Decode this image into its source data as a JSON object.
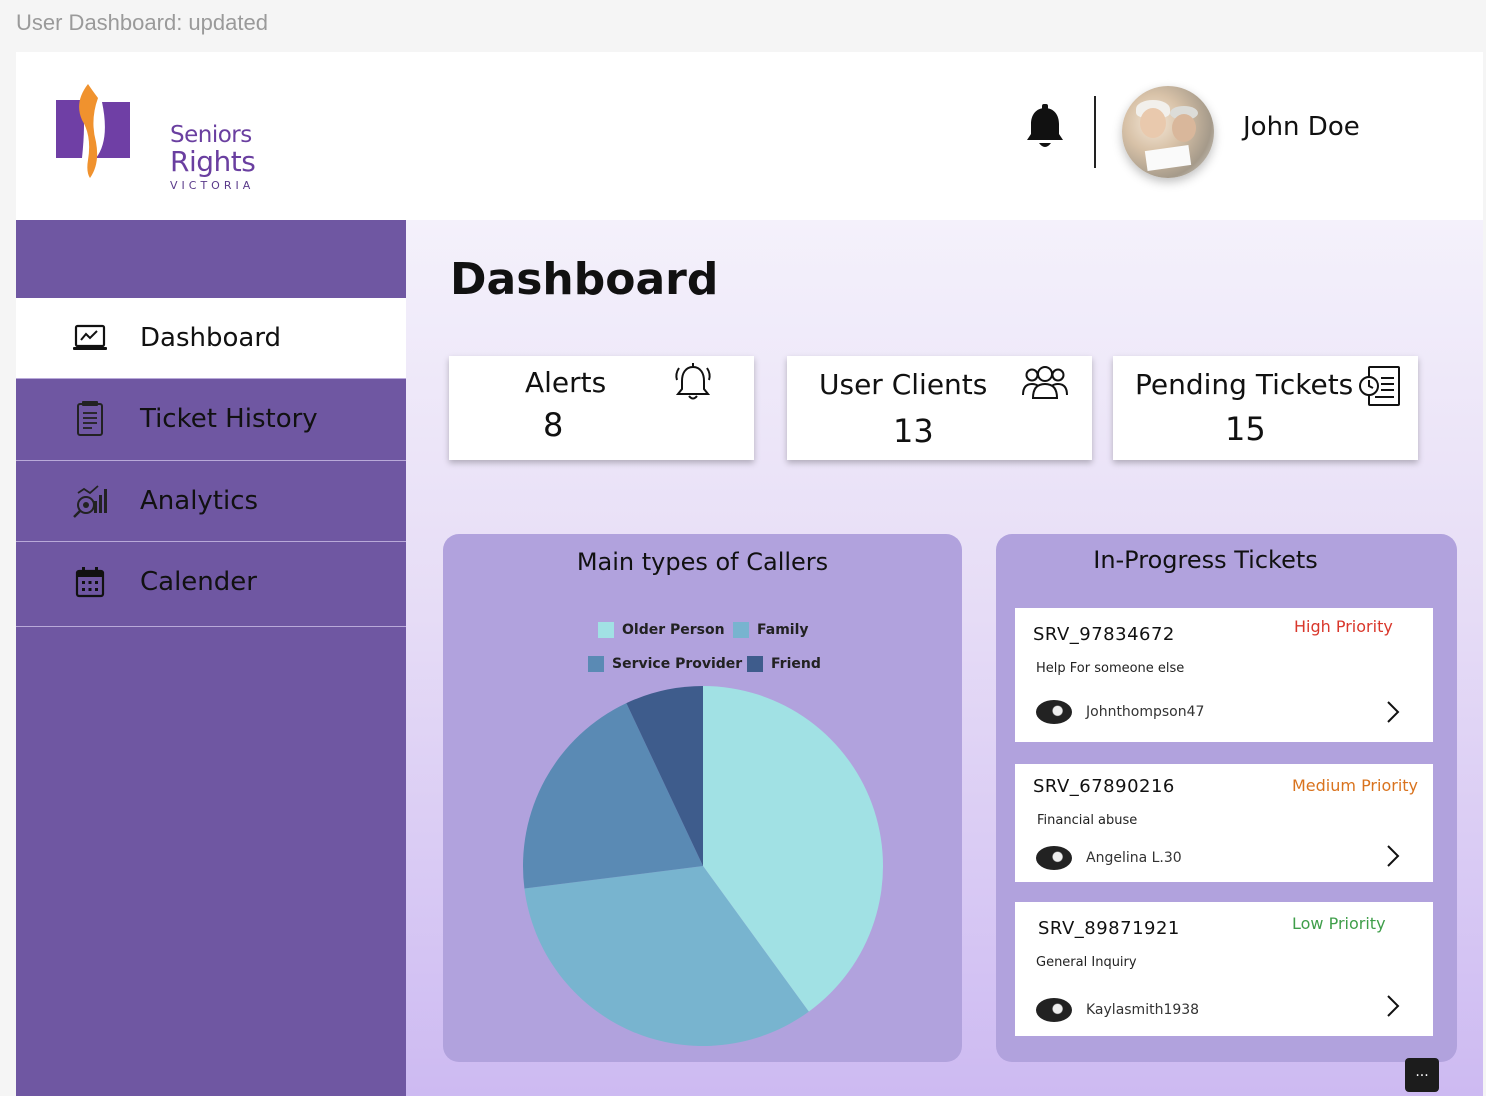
{
  "frame": {
    "label": "User Dashboard: updated"
  },
  "header": {
    "logo": {
      "line1": "Seniors",
      "line2": "Rights",
      "line3": "VICTORIA"
    },
    "notification_icon": "bell-icon",
    "user_name": "John Doe"
  },
  "sidebar": {
    "items": [
      {
        "label": "Dashboard",
        "icon": "monitor-chart-icon",
        "active": true
      },
      {
        "label": "Ticket History",
        "icon": "document-list-icon",
        "active": false
      },
      {
        "label": "Analytics",
        "icon": "analytics-icon",
        "active": false
      },
      {
        "label": "Calender",
        "icon": "calendar-icon",
        "active": false
      }
    ]
  },
  "main": {
    "title": "Dashboard",
    "stats": [
      {
        "label": "Alerts",
        "value": "8",
        "icon": "alarm-bell-icon"
      },
      {
        "label": "User Clients",
        "value": "13",
        "icon": "users-group-icon"
      },
      {
        "label": "Pending Tickets",
        "value": "15",
        "icon": "clock-document-icon"
      }
    ],
    "callers_panel": {
      "title": "Main types of Callers"
    },
    "tickets_panel": {
      "title": "In-Progress Tickets",
      "tickets": [
        {
          "id": "SRV_97834672",
          "priority": "High Priority",
          "priority_color": "#d9372b",
          "description": "Help For someone else",
          "user": "Johnthompson47"
        },
        {
          "id": "SRV_67890216",
          "priority": "Medium Priority",
          "priority_color": "#d9731e",
          "description": "Financial abuse",
          "user": "Angelina L.30"
        },
        {
          "id": "SRV_89871921",
          "priority": "Low Priority",
          "priority_color": "#3f9e4a",
          "description": "General Inquiry",
          "user": "Kaylasmith1938"
        }
      ]
    }
  },
  "chart_data": {
    "type": "pie",
    "title": "Main types of Callers",
    "categories": [
      "Older Person",
      "Family",
      "Service Provider",
      "Friend"
    ],
    "values": [
      40,
      33,
      20,
      7
    ],
    "colors": [
      "#a1e1e4",
      "#78b4cf",
      "#5a8ab4",
      "#3e5c8c"
    ],
    "legend_position": "top"
  },
  "chat_button": {
    "label": "..."
  }
}
